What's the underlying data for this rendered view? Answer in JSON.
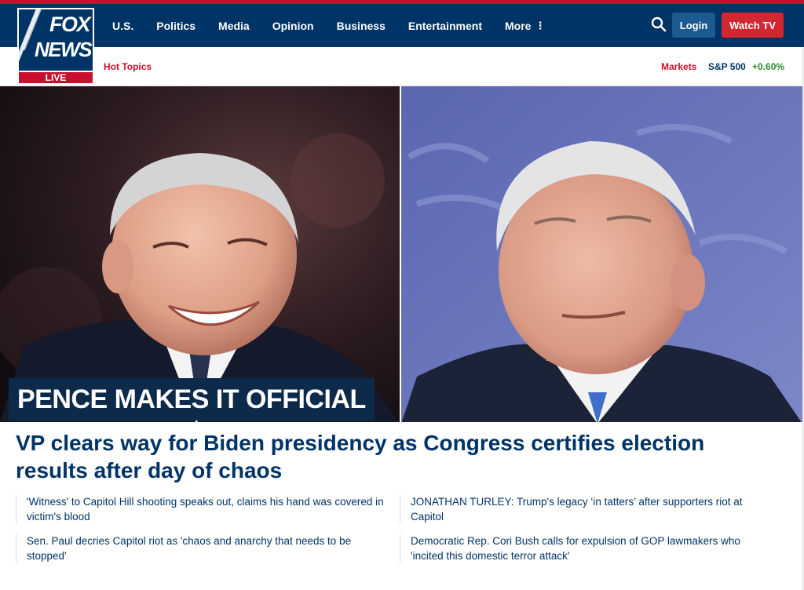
{
  "header": {
    "logo": {
      "line1": "FOX",
      "line2": "NEWS",
      "badge": "LIVE"
    },
    "nav": [
      "U.S.",
      "Politics",
      "Media",
      "Opinion",
      "Business",
      "Entertainment",
      "More"
    ],
    "login_label": "Login",
    "watch_label": "Watch TV",
    "search_icon": "search-icon",
    "more_icon": "vertical-dots-icon"
  },
  "subheader": {
    "hot_topics": "Hot Topics",
    "markets": "Markets",
    "index_name": "S&P 500",
    "index_change": "+0.60%"
  },
  "hero": {
    "banner": "PENCE MAKES IT OFFICIAL",
    "headline": "VP clears way for Biden presidency as Congress certifies election results after day of chaos"
  },
  "related": [
    "'Witness' to Capitol Hill shooting speaks out, claims his hand was covered in victim's blood",
    "JONATHAN TURLEY: Trump's legacy ‘in tatters’ after supporters riot at Capitol",
    "Sen. Paul decries Capitol riot as 'chaos and anarchy that needs to be stopped'",
    "Democratic Rep. Cori Bush calls for expulsion of GOP lawmakers who 'incited this domestic terror attack'"
  ],
  "colors": {
    "navy": "#003366",
    "red": "#c8102e",
    "login_blue": "#1c5a8f",
    "watch_red": "#d22630",
    "positive_green": "#2e8b2e"
  }
}
